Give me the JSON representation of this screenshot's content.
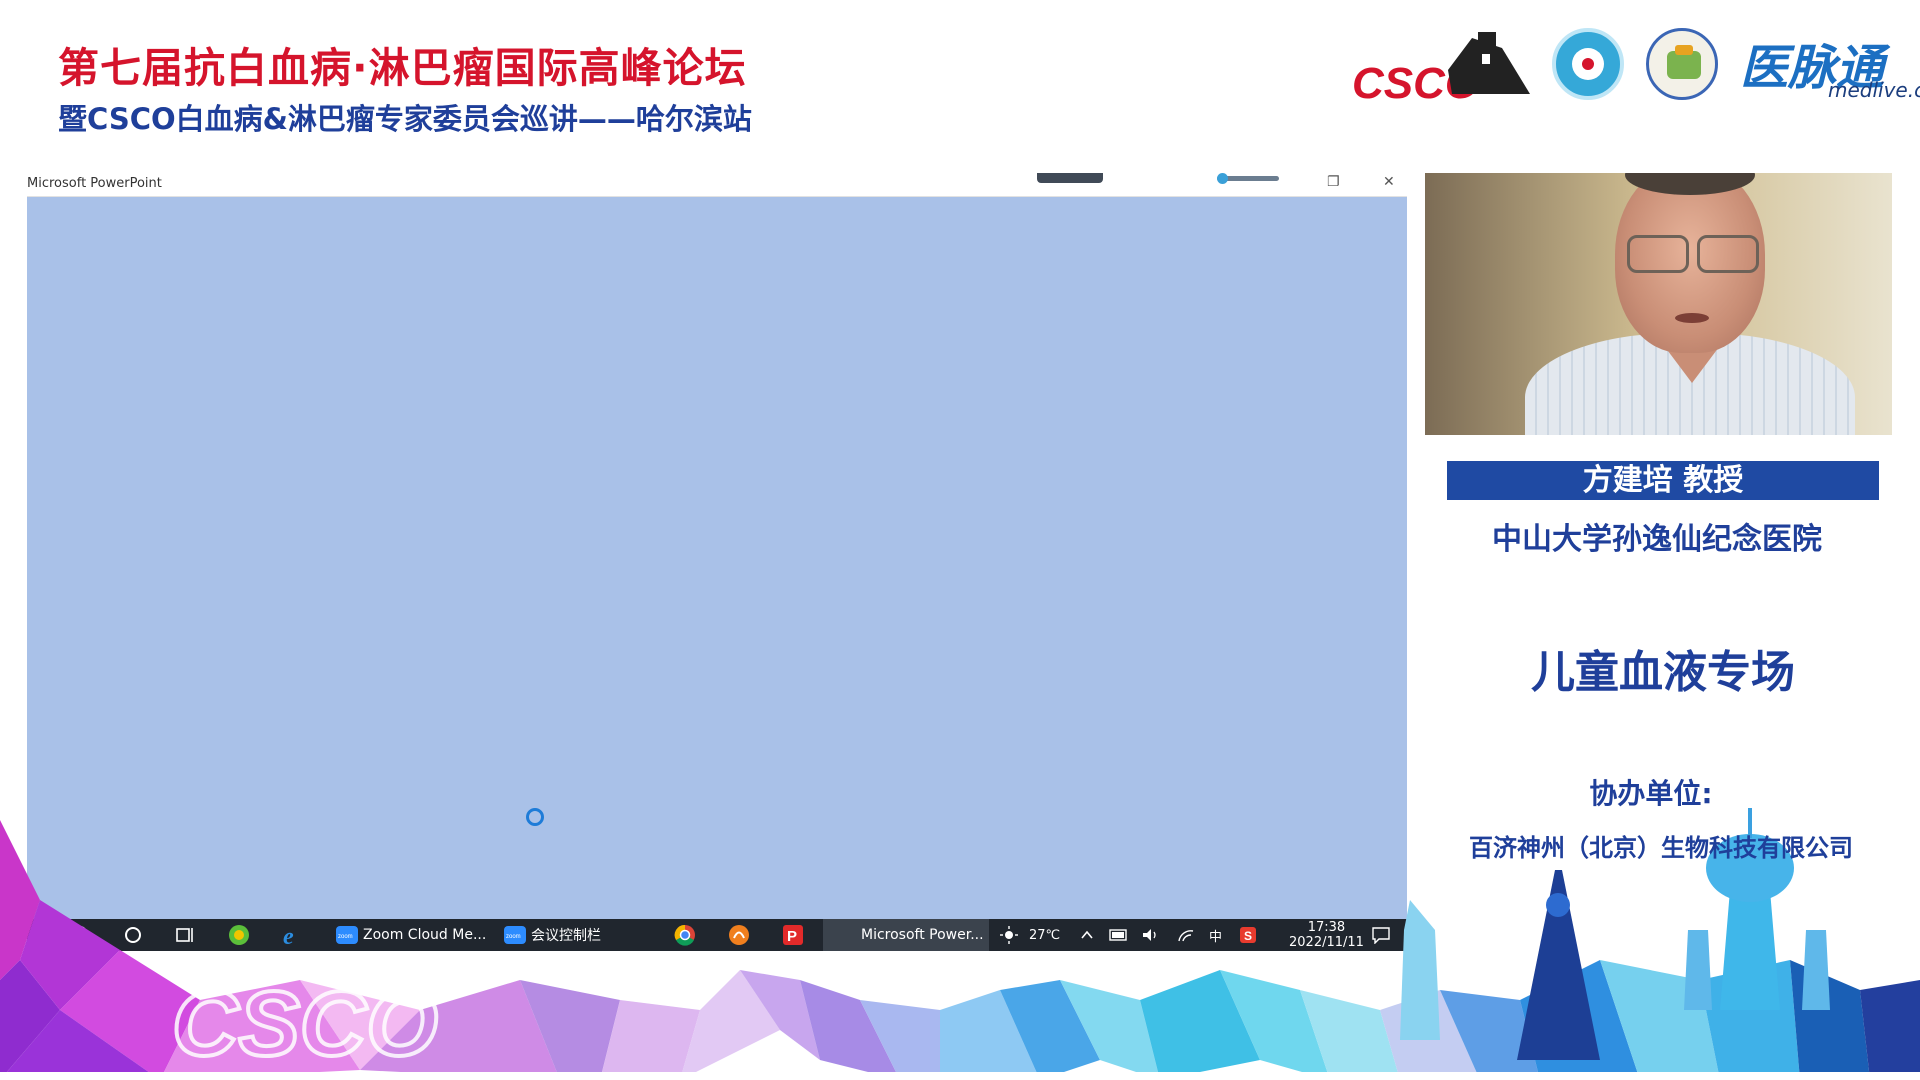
{
  "header": {
    "title": "第七届抗白血病·淋巴瘤国际高峰论坛",
    "subtitle": "暨CSCO白血病&淋巴瘤专家委员会巡讲——哈尔滨站"
  },
  "logos": {
    "csco": "CSCO",
    "medlive_cn": "医脉通",
    "medlive_en": "medlive.cn"
  },
  "share_window": {
    "app_title": "Microsoft PowerPoint",
    "controls": {
      "restore": "❐",
      "close": "✕"
    }
  },
  "taskbar": {
    "items": [
      {
        "label": "Zoom Cloud Me..."
      },
      {
        "label": "会议控制栏"
      },
      {
        "label": "Microsoft Power..."
      }
    ],
    "temperature": "27℃",
    "ime": "中",
    "time": "17:38",
    "date": "2022/11/11"
  },
  "speaker": {
    "name": "方建培 教授",
    "hospital": "中山大学孙逸仙纪念医院"
  },
  "session": "儿童血液专场",
  "co_organizer_label": "协办单位:",
  "co_organizer": "百济神州（北京）生物科技有限公司",
  "colors": {
    "title_red": "#d5142c",
    "brand_blue": "#1f3f9a",
    "namebar_blue": "#1f4aa3",
    "share_bg": "#a9c1e8"
  },
  "icons": [
    "start-icon",
    "search-icon",
    "cortana-icon",
    "task-view-icon",
    "browser-360-icon",
    "ie-icon",
    "zoom-icon",
    "chrome-icon",
    "player-icon",
    "pdf-icon",
    "weather-icon",
    "chevron-up-icon",
    "battery-icon",
    "volume-icon",
    "wifi-icon",
    "sogou-icon",
    "notification-icon",
    "loading-spinner-icon"
  ]
}
